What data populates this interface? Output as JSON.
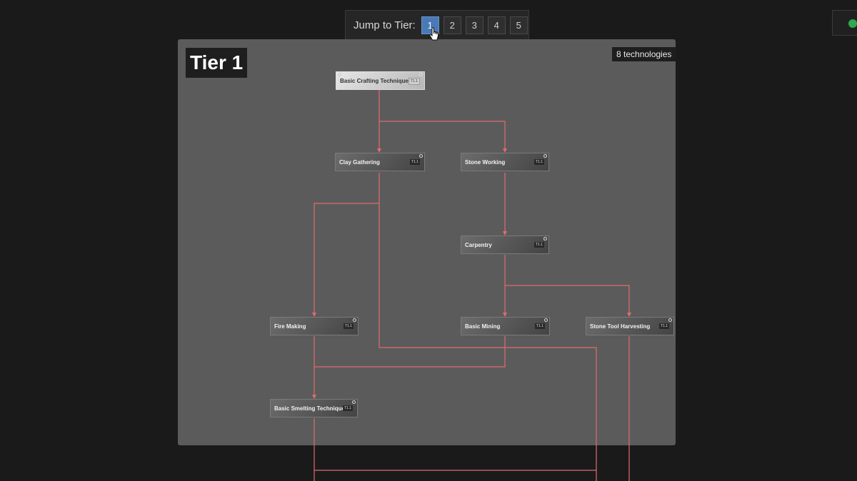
{
  "jump": {
    "label": "Jump to Tier:",
    "tiers": [
      "1",
      "2",
      "3",
      "4",
      "5"
    ],
    "active_tier": "1"
  },
  "panel": {
    "title": "Tier 1",
    "count": "8 technologies"
  },
  "nodes": {
    "basic_crafting": {
      "label": "Basic Crafting Techniques",
      "badge": "T1.1"
    },
    "clay_gathering": {
      "label": "Clay Gathering",
      "badge": "T1.1"
    },
    "stone_working": {
      "label": "Stone Working",
      "badge": "T1.1"
    },
    "carpentry": {
      "label": "Carpentry",
      "badge": "T1.1"
    },
    "fire_making": {
      "label": "Fire Making",
      "badge": "T1.1"
    },
    "basic_mining": {
      "label": "Basic Mining",
      "badge": "T1.1"
    },
    "stone_tool_harvesting": {
      "label": "Stone Tool Harvesting",
      "badge": "T1.1"
    },
    "basic_smelting": {
      "label": "Basic Smelting Techniques",
      "badge": "T1.1"
    }
  },
  "colors": {
    "edge": "#e06a72",
    "active_tier": "#4a7ab5",
    "status_dot": "#2fa84f"
  }
}
